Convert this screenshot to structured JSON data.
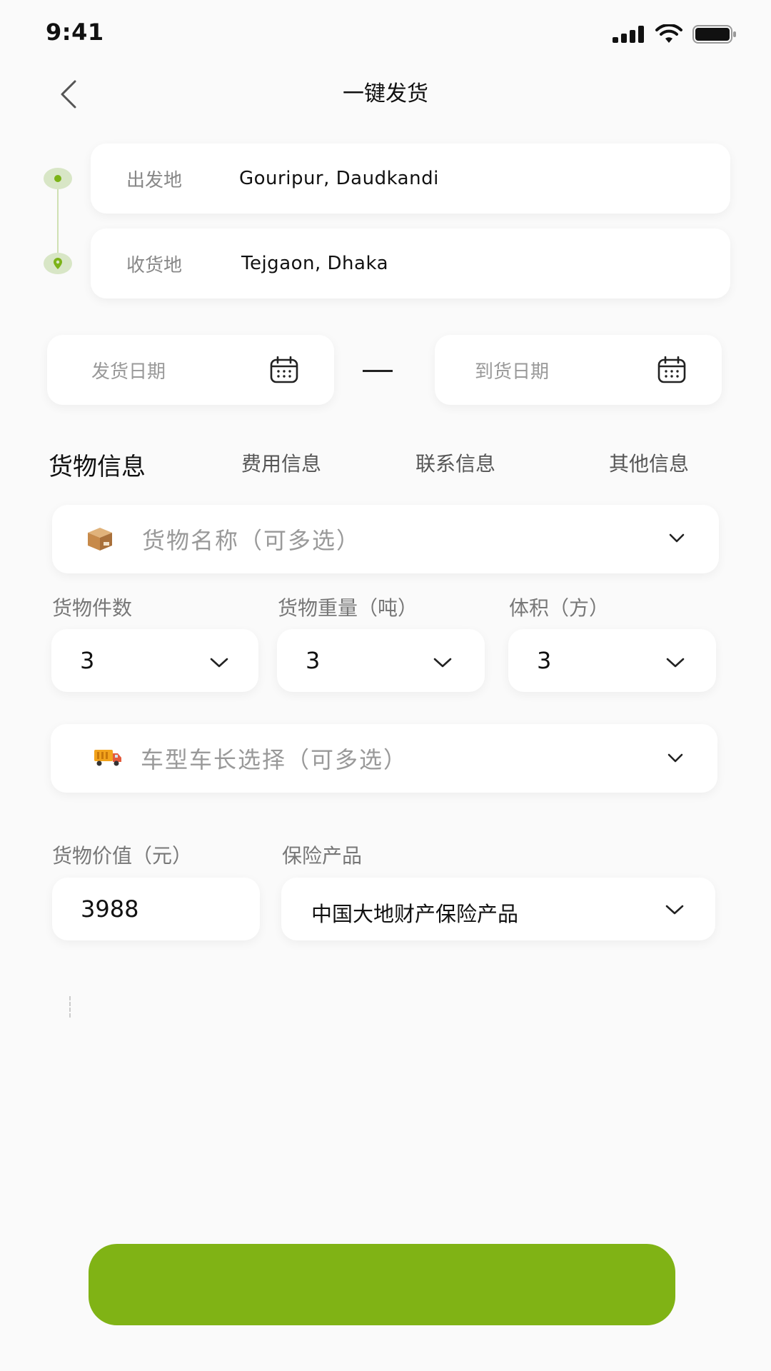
{
  "status_bar": {
    "time": "9:41"
  },
  "header": {
    "title": "一键发货"
  },
  "route": {
    "origin_label": "出发地",
    "origin_value": "Gouripur, Daudkandi",
    "destination_label": "收货地",
    "destination_value": "Tejgaon, Dhaka"
  },
  "dates": {
    "ship_date_placeholder": "发货日期",
    "arrival_date_placeholder": "到货日期"
  },
  "tabs": [
    {
      "label": "货物信息",
      "active": true
    },
    {
      "label": "费用信息",
      "active": false
    },
    {
      "label": "联系信息",
      "active": false
    },
    {
      "label": "其他信息",
      "active": false
    }
  ],
  "goods": {
    "name_placeholder": "货物名称（可多选）",
    "name_icon": "package-icon",
    "count_label": "货物件数",
    "count_value": "3",
    "weight_label": "货物重量（吨）",
    "weight_value": "3",
    "volume_label": "体积（方）",
    "volume_value": "3",
    "vehicle_placeholder": "车型车长选择（可多选）",
    "vehicle_icon": "truck-icon",
    "value_label": "货物价值（元）",
    "value_value": "3988",
    "insurance_label": "保险产品",
    "insurance_value": "中国大地财产保险产品"
  },
  "colors": {
    "accent": "#80b315",
    "route_dot_bg": "#d8e6c6",
    "route_dot": "#7cb318"
  }
}
